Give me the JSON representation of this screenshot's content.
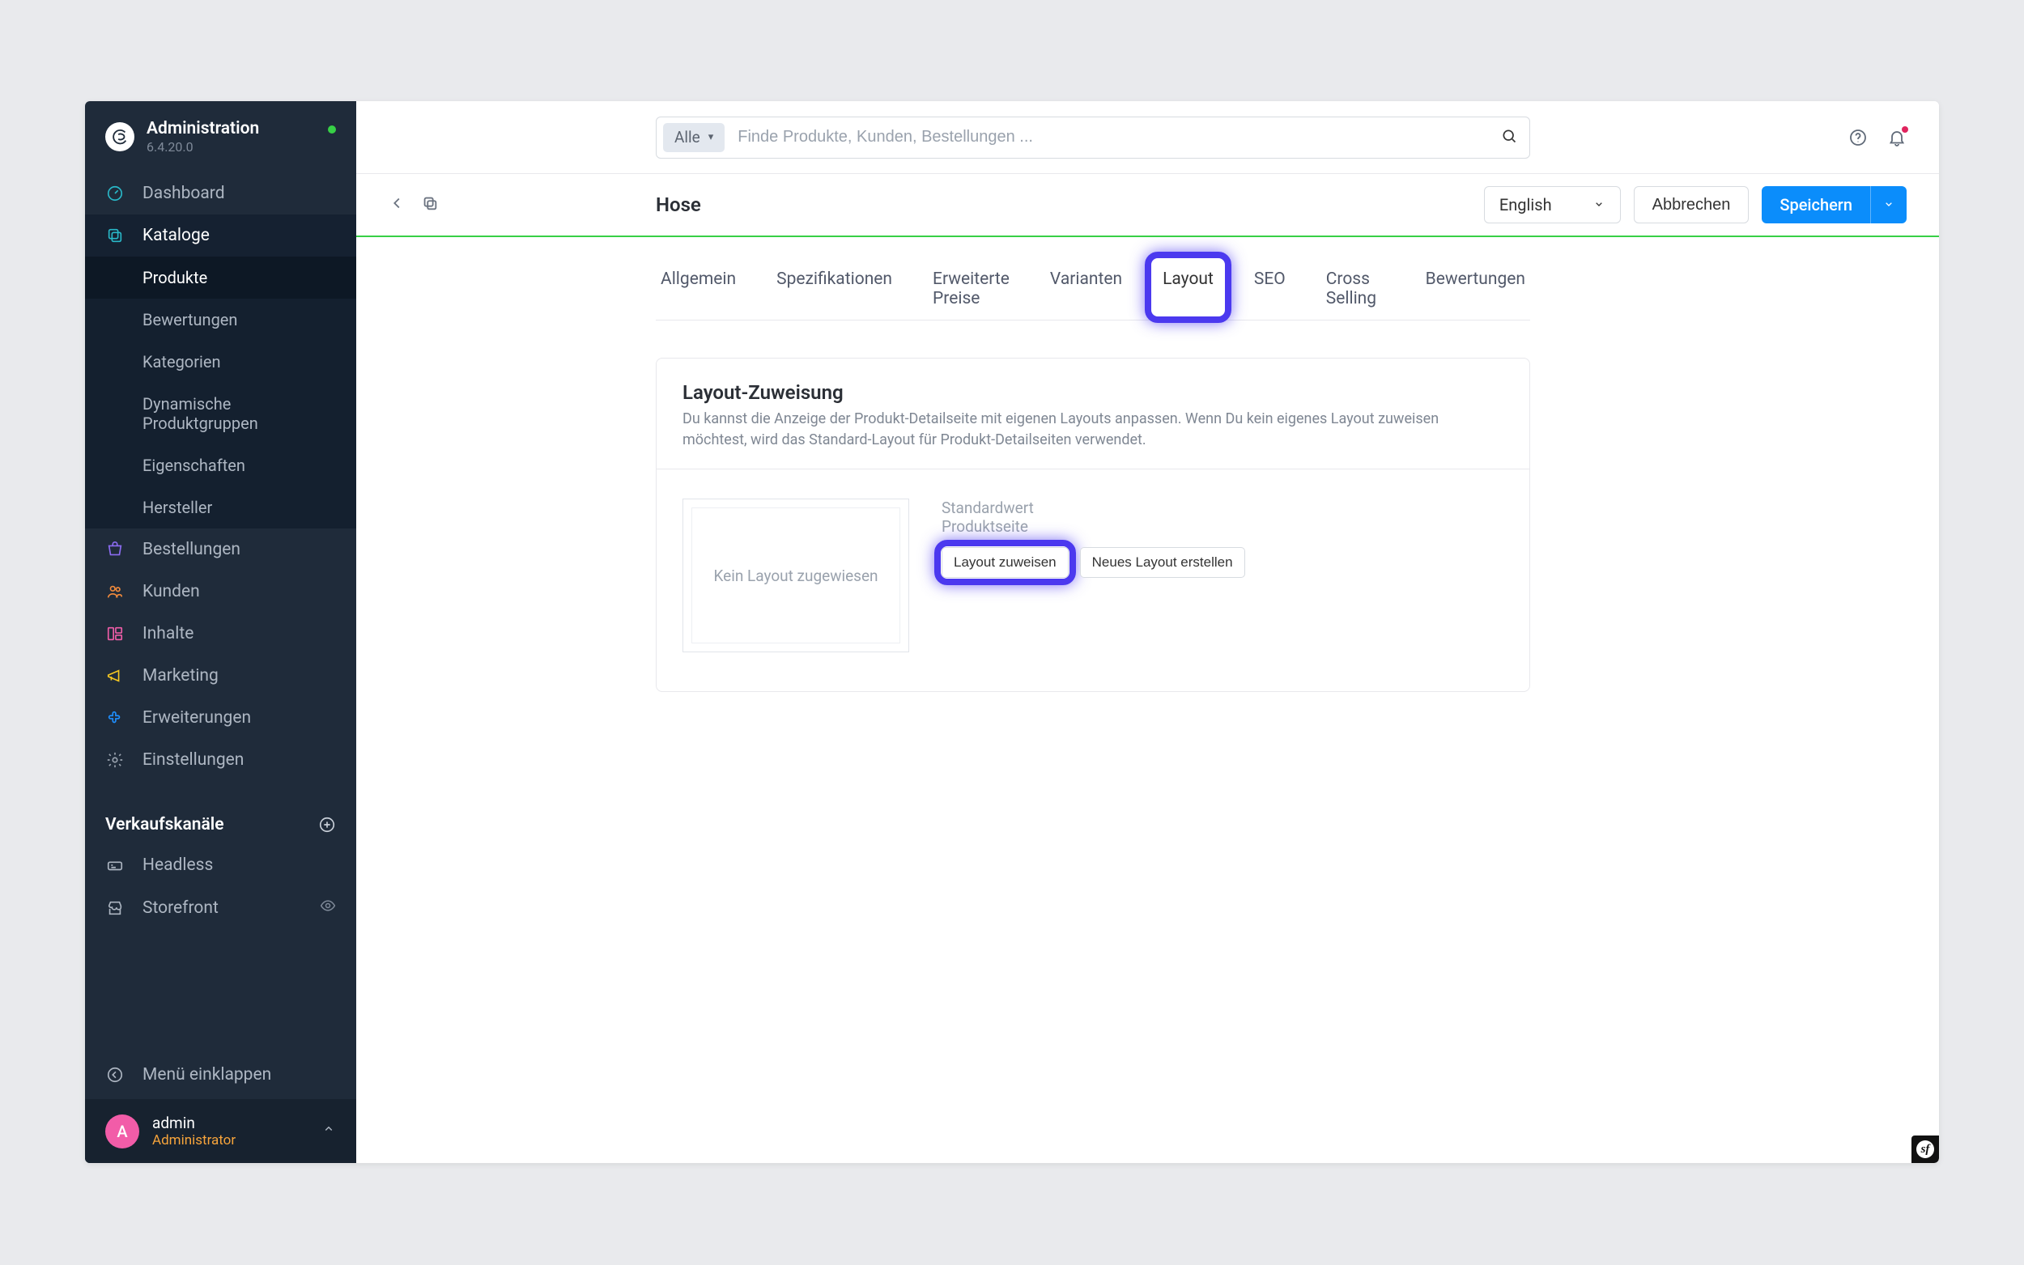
{
  "app": {
    "title": "Administration",
    "version": "6.4.20.0"
  },
  "search": {
    "filter_label": "Alle",
    "placeholder": "Finde Produkte, Kunden, Bestellungen ..."
  },
  "nav": {
    "dashboard": "Dashboard",
    "kataloge": "Kataloge",
    "bestellungen": "Bestellungen",
    "kunden": "Kunden",
    "inhalte": "Inhalte",
    "marketing": "Marketing",
    "erweiterungen": "Erweiterungen",
    "einstellungen": "Einstellungen",
    "verkaufskanaele": "Verkaufskanäle",
    "headless": "Headless",
    "storefront": "Storefront",
    "collapse": "Menü einklappen"
  },
  "nav_kataloge": {
    "produkte": "Produkte",
    "bewertungen": "Bewertungen",
    "kategorien": "Kategorien",
    "dyn_gruppen": "Dynamische Produktgruppen",
    "eigenschaften": "Eigenschaften",
    "hersteller": "Hersteller"
  },
  "user": {
    "initial": "A",
    "name": "admin",
    "role": "Administrator"
  },
  "page": {
    "title": "Hose",
    "language": "English",
    "cancel": "Abbrechen",
    "save": "Speichern"
  },
  "tabs": {
    "allgemein": "Allgemein",
    "spezifikationen": "Spezifikationen",
    "erweiterte_preise": "Erweiterte Preise",
    "varianten": "Varianten",
    "layout": "Layout",
    "seo": "SEO",
    "cross_selling": "Cross Selling",
    "bewertungen": "Bewertungen"
  },
  "layout_card": {
    "title": "Layout-Zuweisung",
    "description": "Du kannst die Anzeige der Produkt-Detailseite mit eigenen Layouts anpassen. Wenn Du kein eigenes Layout zuweisen möchtest, wird das Standard-Layout für Produkt-Detailseiten verwendet.",
    "preview_empty": "Kein Layout zugewiesen",
    "default_label": "Standardwert",
    "default_page": "Produktseite",
    "assign_button": "Layout zuweisen",
    "new_button": "Neues Layout erstellen"
  }
}
